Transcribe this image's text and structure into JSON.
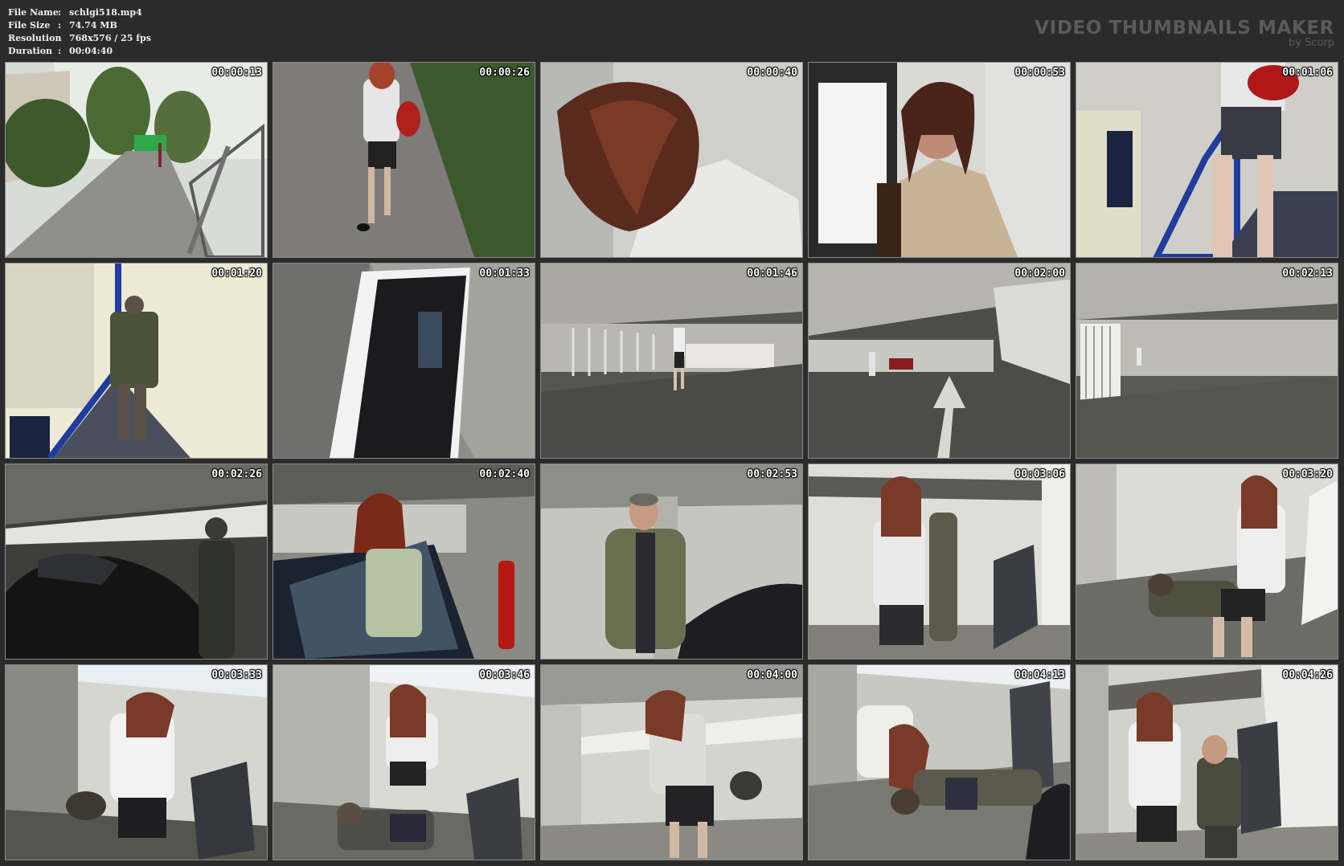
{
  "file_info": {
    "rows": [
      {
        "key": "File Name",
        "sep": ":",
        "value": "schlgi518.mp4"
      },
      {
        "key": "File Size",
        "sep": ":",
        "value": "74.74 MB"
      },
      {
        "key": "Resolution",
        "sep": ":",
        "value": "768x576 / 25 fps"
      },
      {
        "key": "Duration",
        "sep": ":",
        "value": "00:04:40"
      }
    ]
  },
  "brand": {
    "title": "VIDEO THUMBNAILS MAKER",
    "subtitle": "by Scorp"
  },
  "thumbnails": [
    {
      "time": "00:00:13"
    },
    {
      "time": "00:00:26"
    },
    {
      "time": "00:00:40"
    },
    {
      "time": "00:00:53"
    },
    {
      "time": "00:01:06"
    },
    {
      "time": "00:01:20"
    },
    {
      "time": "00:01:33"
    },
    {
      "time": "00:01:46"
    },
    {
      "time": "00:02:00"
    },
    {
      "time": "00:02:13"
    },
    {
      "time": "00:02:26"
    },
    {
      "time": "00:02:40"
    },
    {
      "time": "00:02:53"
    },
    {
      "time": "00:03:06"
    },
    {
      "time": "00:03:20"
    },
    {
      "time": "00:03:33"
    },
    {
      "time": "00:03:46"
    },
    {
      "time": "00:04:00"
    },
    {
      "time": "00:04:13"
    },
    {
      "time": "00:04:26"
    }
  ],
  "colors": {
    "background": "#2b2b2b",
    "text": "#f2f2f2",
    "brand": "#5a5a5a",
    "thumb_border": "#8a8a8a"
  }
}
